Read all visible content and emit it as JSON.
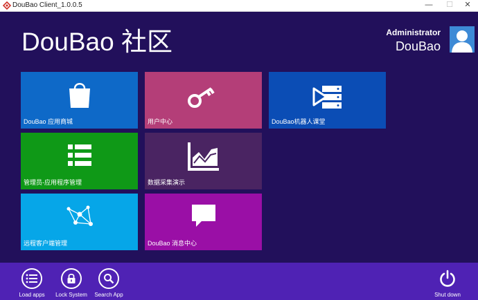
{
  "window": {
    "title": "DouBao Client_1.0.0.5",
    "minimize": "—",
    "maximize": "☐",
    "close": "✕"
  },
  "header": {
    "brand": "DouBao 社区"
  },
  "user": {
    "role": "Administrator",
    "name": "DouBao"
  },
  "tiles": [
    {
      "label": "DouBao 应用商城",
      "color": "#0e69c8",
      "icon": "shopping-bag-icon"
    },
    {
      "label": "用户中心",
      "color": "#b43e78",
      "icon": "key-icon"
    },
    {
      "label": "DouBao机器人课堂",
      "color": "#0b4db5",
      "icon": "servers-icon"
    },
    {
      "label": "管理员-应用程序管理",
      "color": "#0f9917",
      "icon": "list-icon"
    },
    {
      "label": "数据采集演示",
      "color": "#4a2462",
      "icon": "chart-icon"
    },
    {
      "label": "远程客户端管理",
      "color": "#06a6e8",
      "icon": "network-icon"
    },
    {
      "label": "DouBao 消息中心",
      "color": "#9a0fa6",
      "icon": "message-icon"
    }
  ],
  "taskbar": {
    "load_apps": "Load apps",
    "lock_system": "Lock System",
    "search_app": "Search App",
    "shut_down": "Shut down"
  }
}
